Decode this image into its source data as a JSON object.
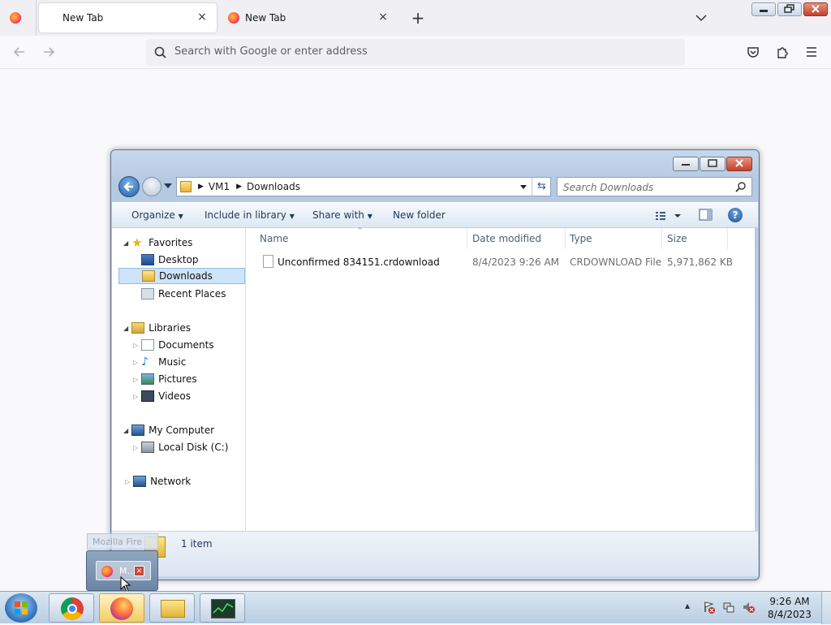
{
  "browser": {
    "tabs": [
      {
        "label": "New Tab",
        "active": true
      },
      {
        "label": "New Tab",
        "active": false
      }
    ],
    "new_tab_symbol": "+",
    "close_symbol": "×",
    "list_tabs_symbol": "⌄",
    "search_placeholder": "Search with Google or enter address",
    "window_buttons": [
      "minimize",
      "restore",
      "close"
    ]
  },
  "explorer": {
    "breadcrumb": [
      "VM1",
      "Downloads"
    ],
    "search_placeholder": "Search Downloads",
    "toolbar": {
      "organize": "Organize",
      "include": "Include in library",
      "share": "Share with",
      "new_folder": "New folder"
    },
    "nav": {
      "favorites": "Favorites",
      "desktop": "Desktop",
      "downloads": "Downloads",
      "recent": "Recent Places",
      "libraries": "Libraries",
      "documents": "Documents",
      "music": "Music",
      "pictures": "Pictures",
      "videos": "Videos",
      "computer": "My Computer",
      "local_disk": "Local Disk (C:)",
      "network": "Network"
    },
    "columns": {
      "name": "Name",
      "date": "Date modified",
      "type": "Type",
      "size": "Size"
    },
    "files": [
      {
        "name": "Unconfirmed 834151.crdownload",
        "date": "8/4/2023 9:26 AM",
        "type": "CRDOWNLOAD File",
        "size": "5,971,862 KB"
      }
    ],
    "status": "1 item"
  },
  "taskbar": {
    "thumb_ghost": "Mozilla Fire",
    "thumb_label": "M..",
    "time": "9:26 AM",
    "date": "8/4/2023",
    "show_hidden": "▲"
  }
}
